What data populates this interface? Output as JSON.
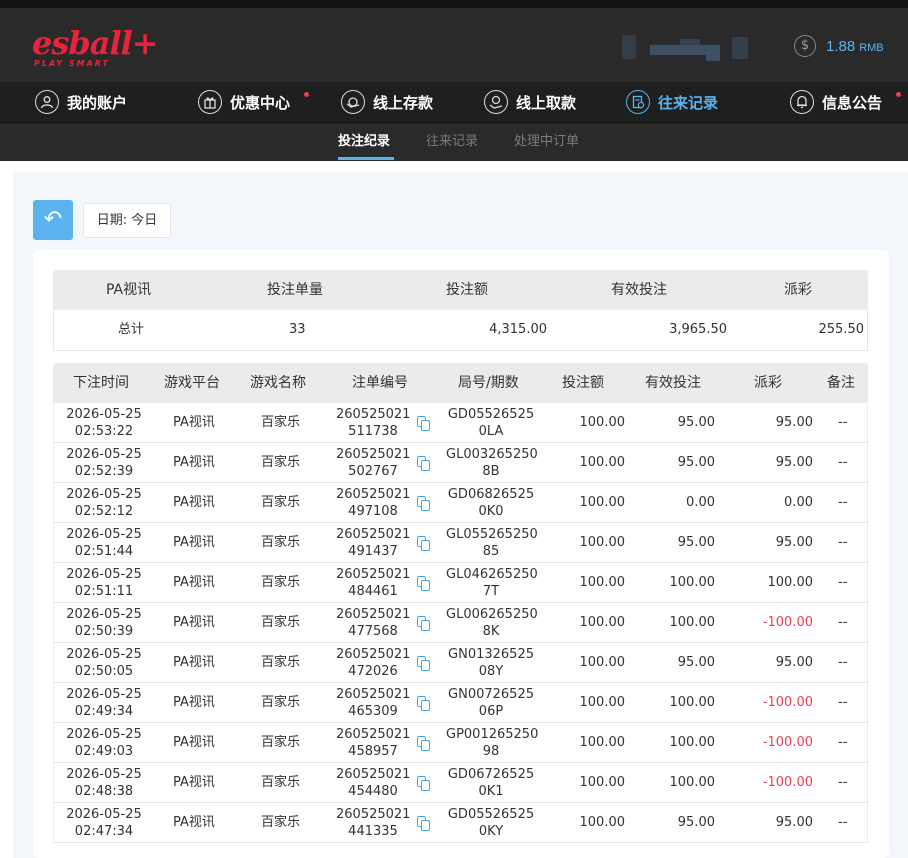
{
  "header": {
    "logo_main": "esball+",
    "logo_sub": "PLAY SMART",
    "balance_value": "1.88",
    "balance_currency": "RMB",
    "coin_symbol": "$"
  },
  "nav": [
    {
      "label": "我的账户",
      "icon": "user-icon"
    },
    {
      "label": "优惠中心",
      "icon": "gift-icon"
    },
    {
      "label": "线上存款",
      "icon": "deposit-icon"
    },
    {
      "label": "线上取款",
      "icon": "withdraw-icon"
    },
    {
      "label": "往来记录",
      "icon": "records-icon"
    },
    {
      "label": "信息公告",
      "icon": "bell-icon"
    }
  ],
  "subnav": [
    "投注纪录",
    "往来记录",
    "处理中订单"
  ],
  "colors": {
    "accent": "#5bb4f0",
    "negative": "#e8435a",
    "brand": "#e8243c"
  },
  "toolbar": {
    "back_icon": "↶",
    "date_label": "日期: 今日"
  },
  "summary": {
    "headers": [
      "PA视讯",
      "投注单量",
      "投注额",
      "有效投注",
      "派彩"
    ],
    "row": [
      "总计",
      "33",
      "4,315.00",
      "3,965.50",
      "255.50"
    ]
  },
  "table": {
    "headers": [
      "下注时间",
      "游戏平台",
      "游戏名称",
      "注单编号",
      "局号/期数",
      "投注额",
      "有效投注",
      "派彩",
      "备注"
    ],
    "rows": [
      {
        "date": "2026-05-25",
        "time": "02:53:22",
        "platform": "PA视讯",
        "game": "百家乐",
        "id1": "260525021",
        "id2": "511738",
        "round1": "GD05526525",
        "round2": "0LA",
        "bet": "100.00",
        "valid": "95.00",
        "payout": "95.00",
        "note": "--"
      },
      {
        "date": "2026-05-25",
        "time": "02:52:39",
        "platform": "PA视讯",
        "game": "百家乐",
        "id1": "260525021",
        "id2": "502767",
        "round1": "GL003265250",
        "round2": "8B",
        "bet": "100.00",
        "valid": "95.00",
        "payout": "95.00",
        "note": "--"
      },
      {
        "date": "2026-05-25",
        "time": "02:52:12",
        "platform": "PA视讯",
        "game": "百家乐",
        "id1": "260525021",
        "id2": "497108",
        "round1": "GD06826525",
        "round2": "0K0",
        "bet": "100.00",
        "valid": "0.00",
        "payout": "0.00",
        "note": "--"
      },
      {
        "date": "2026-05-25",
        "time": "02:51:44",
        "platform": "PA视讯",
        "game": "百家乐",
        "id1": "260525021",
        "id2": "491437",
        "round1": "GL055265250",
        "round2": "85",
        "bet": "100.00",
        "valid": "95.00",
        "payout": "95.00",
        "note": "--"
      },
      {
        "date": "2026-05-25",
        "time": "02:51:11",
        "platform": "PA视讯",
        "game": "百家乐",
        "id1": "260525021",
        "id2": "484461",
        "round1": "GL046265250",
        "round2": "7T",
        "bet": "100.00",
        "valid": "100.00",
        "payout": "100.00",
        "note": "--"
      },
      {
        "date": "2026-05-25",
        "time": "02:50:39",
        "platform": "PA视讯",
        "game": "百家乐",
        "id1": "260525021",
        "id2": "477568",
        "round1": "GL006265250",
        "round2": "8K",
        "bet": "100.00",
        "valid": "100.00",
        "payout": "-100.00",
        "note": "--"
      },
      {
        "date": "2026-05-25",
        "time": "02:50:05",
        "platform": "PA视讯",
        "game": "百家乐",
        "id1": "260525021",
        "id2": "472026",
        "round1": "GN01326525",
        "round2": "08Y",
        "bet": "100.00",
        "valid": "95.00",
        "payout": "95.00",
        "note": "--"
      },
      {
        "date": "2026-05-25",
        "time": "02:49:34",
        "platform": "PA视讯",
        "game": "百家乐",
        "id1": "260525021",
        "id2": "465309",
        "round1": "GN00726525",
        "round2": "06P",
        "bet": "100.00",
        "valid": "100.00",
        "payout": "-100.00",
        "note": "--"
      },
      {
        "date": "2026-05-25",
        "time": "02:49:03",
        "platform": "PA视讯",
        "game": "百家乐",
        "id1": "260525021",
        "id2": "458957",
        "round1": "GP001265250",
        "round2": "98",
        "bet": "100.00",
        "valid": "100.00",
        "payout": "-100.00",
        "note": "--"
      },
      {
        "date": "2026-05-25",
        "time": "02:48:38",
        "platform": "PA视讯",
        "game": "百家乐",
        "id1": "260525021",
        "id2": "454480",
        "round1": "GD06726525",
        "round2": "0K1",
        "bet": "100.00",
        "valid": "100.00",
        "payout": "-100.00",
        "note": "--"
      },
      {
        "date": "2026-05-25",
        "time": "02:47:34",
        "platform": "PA视讯",
        "game": "百家乐",
        "id1": "260525021",
        "id2": "441335",
        "round1": "GD05526525",
        "round2": "0KY",
        "bet": "100.00",
        "valid": "95.00",
        "payout": "95.00",
        "note": "--"
      }
    ]
  }
}
